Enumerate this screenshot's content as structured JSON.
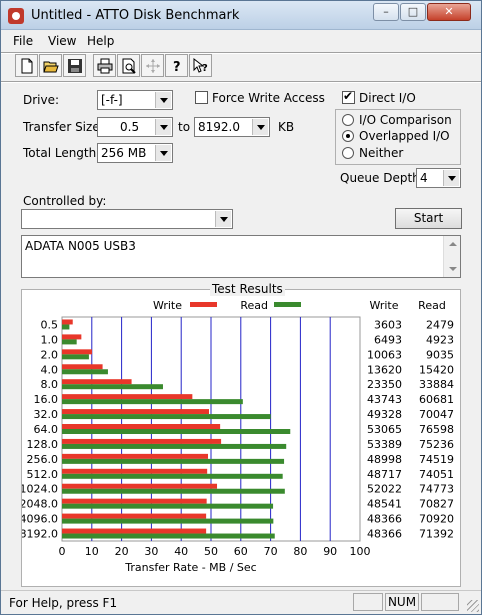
{
  "window": {
    "title": "Untitled - ATTO Disk Benchmark",
    "controls": {
      "minimize": "–",
      "maximize": "□",
      "close": "✕"
    }
  },
  "menu": {
    "file": "File",
    "view": "View",
    "help": "Help"
  },
  "toolbar": {
    "icons": [
      "new-icon",
      "open-icon",
      "save-icon",
      "print-icon",
      "print-preview-icon",
      "move-icon",
      "help-icon",
      "context-help-icon"
    ]
  },
  "form": {
    "drive_label": "Drive:",
    "drive_value": "[-f-]",
    "force_write_label": "Force Write Access",
    "force_write_checked": false,
    "direct_io_label": "Direct I/O",
    "direct_io_checked": true,
    "transfer_size_label": "Transfer Size:",
    "transfer_min": "0.5",
    "transfer_to": "to",
    "transfer_max": "8192.0",
    "transfer_unit": "KB",
    "total_length_label": "Total Length:",
    "total_length_value": "256 MB",
    "io_options": [
      {
        "label": "I/O Comparison",
        "selected": false
      },
      {
        "label": "Overlapped I/O",
        "selected": true
      },
      {
        "label": "Neither",
        "selected": false
      }
    ],
    "queue_depth_label": "Queue Depth:",
    "queue_depth_value": "4",
    "controlled_by_label": "Controlled by:",
    "controlled_by_value": "",
    "start_label": "Start",
    "description": "ADATA N005  USB3"
  },
  "results": {
    "title": "Test Results",
    "write_col": "Write",
    "read_col": "Read"
  },
  "chart_data": {
    "type": "bar",
    "orientation": "horizontal",
    "categories": [
      "0.5",
      "1.0",
      "2.0",
      "4.0",
      "8.0",
      "16.0",
      "32.0",
      "64.0",
      "128.0",
      "256.0",
      "512.0",
      "1024.0",
      "2048.0",
      "4096.0",
      "8192.0"
    ],
    "series": [
      {
        "name": "Write",
        "color": "#e8372a",
        "values": [
          3603,
          6493,
          10063,
          13620,
          23350,
          43743,
          49328,
          53065,
          53389,
          48998,
          48717,
          52022,
          48541,
          48366,
          48366
        ]
      },
      {
        "name": "Read",
        "color": "#3a8a2e",
        "values": [
          2479,
          4923,
          9035,
          15420,
          33884,
          60681,
          70047,
          76598,
          75236,
          74519,
          74051,
          74773,
          70827,
          70920,
          71392
        ]
      }
    ],
    "xlabel": "Transfer Rate - MB / Sec",
    "xlim": [
      0,
      100
    ],
    "xticks": [
      "0",
      "10",
      "20",
      "30",
      "40",
      "50",
      "60",
      "70",
      "80",
      "90",
      "100"
    ],
    "scale_mb_per_unit": 1000,
    "legend": "top",
    "grid": true,
    "grid_color": "#2323c8"
  },
  "status": {
    "help_text": "For Help, press F1",
    "num": "NUM"
  }
}
